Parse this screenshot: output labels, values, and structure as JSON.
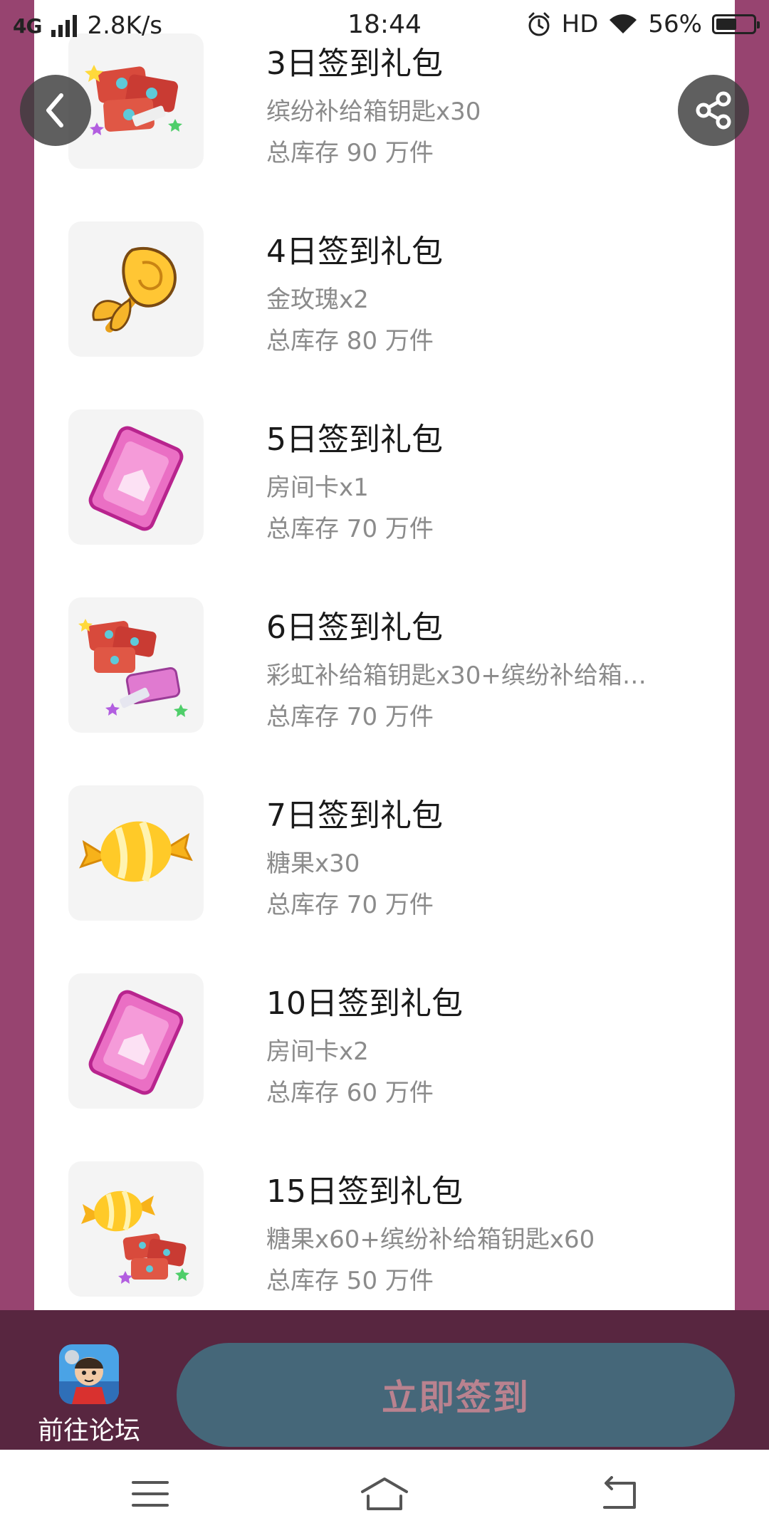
{
  "status_bar": {
    "network": "4G",
    "speed": "2.8K/s",
    "time": "18:44",
    "hd": "HD",
    "battery": "56%",
    "battery_level": 0.56
  },
  "rewards": [
    {
      "title": "3日签到礼包",
      "desc": "缤纷补给箱钥匙x30",
      "stock": "总库存 90 万件",
      "icon": "key-bundle-icon"
    },
    {
      "title": "4日签到礼包",
      "desc": "金玫瑰x2",
      "stock": "总库存 80 万件",
      "icon": "gold-rose-icon"
    },
    {
      "title": "5日签到礼包",
      "desc": "房间卡x1",
      "stock": "总库存 70 万件",
      "icon": "room-card-icon"
    },
    {
      "title": "6日签到礼包",
      "desc": "彩虹补给箱钥匙x30+缤纷补给箱…",
      "stock": "总库存 70 万件",
      "icon": "rainbow-key-bundle-icon"
    },
    {
      "title": "7日签到礼包",
      "desc": "糖果x30",
      "stock": "总库存 70 万件",
      "icon": "candy-icon"
    },
    {
      "title": "10日签到礼包",
      "desc": "房间卡x2",
      "stock": "总库存 60 万件",
      "icon": "room-card-icon"
    },
    {
      "title": "15日签到礼包",
      "desc": "糖果x60+缤纷补给箱钥匙x60",
      "stock": "总库存 50 万件",
      "icon": "candy-key-bundle-icon"
    }
  ],
  "footer": {
    "forum_label": "前往论坛",
    "signin_label": "立即签到"
  },
  "colors": {
    "page_frame": "#974470",
    "action_bar": "#582640",
    "signin_button": "#456779",
    "signin_text": "#b9828f"
  }
}
